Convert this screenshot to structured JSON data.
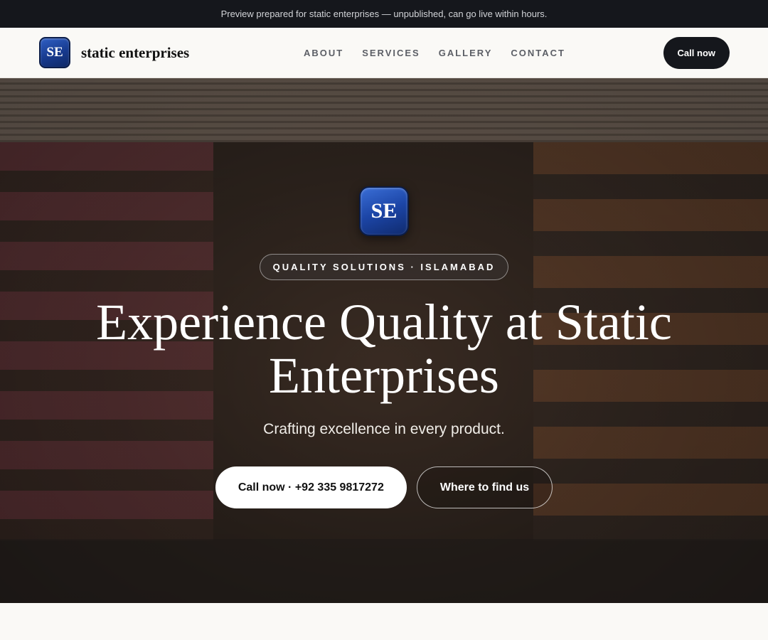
{
  "announcement": "Preview prepared for static enterprises — unpublished, can go live within hours.",
  "brand": {
    "initials": "SE",
    "name": "static enterprises"
  },
  "nav": {
    "items": [
      {
        "label": "ABOUT"
      },
      {
        "label": "SERVICES"
      },
      {
        "label": "GALLERY"
      },
      {
        "label": "CONTACT"
      }
    ],
    "cta": "Call now"
  },
  "hero": {
    "logo_initials": "SE",
    "badge": "QUALITY SOLUTIONS · ISLAMABAD",
    "title": "Experience Quality at Static Enterprises",
    "subtitle": "Crafting excellence in every product.",
    "primary_cta": "Call now · +92 335 9817272",
    "secondary_cta": "Where to find us"
  },
  "colors": {
    "dark": "#15171c",
    "page_bg": "#faf9f6",
    "logo_blue": "#1c45a6"
  }
}
